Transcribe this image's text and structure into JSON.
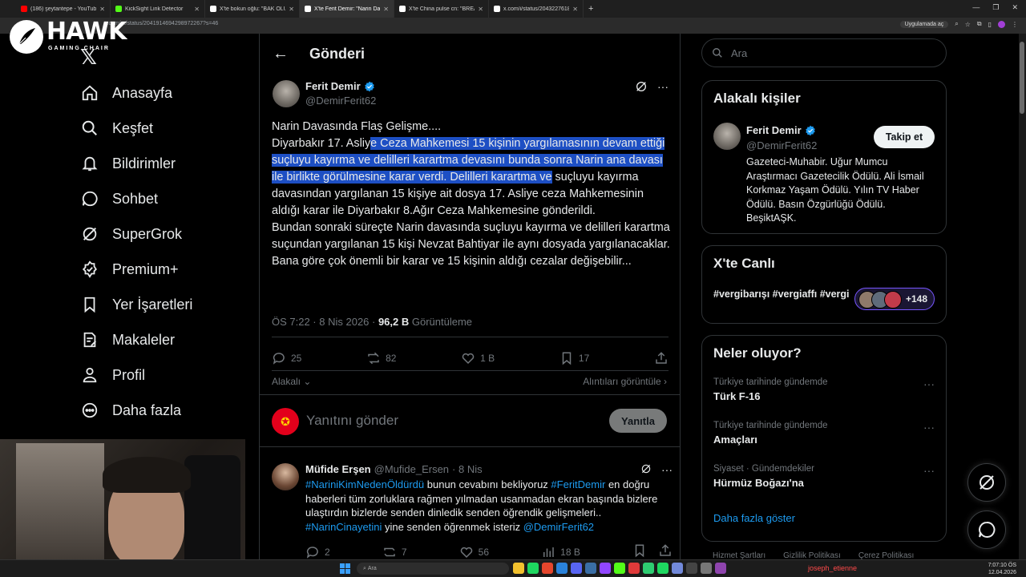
{
  "browser": {
    "tabs": [
      {
        "title": "(186) şeytantepe - YouTube",
        "color": "#ff0000"
      },
      {
        "title": "KickSight Link Detector",
        "color": "#53fc18"
      },
      {
        "title": "X'te bokun oğlu: \"BAK ÖLÜYOR",
        "color": "#ffffff"
      },
      {
        "title": "X'te Ferit Demir: \"Narin Davası",
        "color": "#ffffff"
      },
      {
        "title": "X'te China pulse cn: \"BREAKING",
        "color": "#ffffff"
      },
      {
        "title": "x.com/i/status/204322761853",
        "color": "#ffffff"
      }
    ],
    "url": "x.com/.../status/2041914694298972267?s=46",
    "profile_button": "Uygulamada aç"
  },
  "logo": {
    "word": "HAWK",
    "sub": "GAMING CHAIR"
  },
  "nav": {
    "items": [
      {
        "label": "Anasayfa",
        "icon": "home-icon"
      },
      {
        "label": "Keşfet",
        "icon": "search-icon"
      },
      {
        "label": "Bildirimler",
        "icon": "bell-icon"
      },
      {
        "label": "Sohbet",
        "icon": "chat-icon"
      },
      {
        "label": "SuperGrok",
        "icon": "grok-icon"
      },
      {
        "label": "Premium+",
        "icon": "premium-icon"
      },
      {
        "label": "Yer İşaretleri",
        "icon": "bookmark-icon"
      },
      {
        "label": "Makaleler",
        "icon": "article-icon"
      },
      {
        "label": "Profil",
        "icon": "profile-icon"
      },
      {
        "label": "Daha fazla",
        "icon": "more-icon"
      }
    ]
  },
  "header": {
    "title": "Gönderi"
  },
  "post": {
    "author_name": "Ferit Demir",
    "author_handle": "@DemirFerit62",
    "line1": "Narin Davasında Flaş Gelişme....",
    "line2_pre": "Diyarbakır 17. Asliy",
    "line2_sel": "e Ceza Mahkemesi 15 kişinin yargılamasının devam ettiği suçluyu kayırma ve delilleri karartma devasını bunda sonra Narin ana davası ile birlikte görülmesine karar verdi. Delilleri karartma ve",
    "line2_post": " suçluyu kayırma davasından yargılanan 15 kişiye ait dosya 17. Asliye ceza Mahkemesinin aldığı karar ile  Diyarbakır 8.Ağır Ceza Mahkemesine gönderildi.",
    "line3": "Bundan sonraki süreçte Narin davasında suçluyu kayırma ve delilleri karartma suçundan yargılanan 15 kişi   Nevzat Bahtiyar ile aynı dosyada yargılanacaklar.",
    "line4": "Bana göre çok önemli bir karar ve 15 kişinin aldığı cezalar değişebilir...",
    "time": "ÖS 7:22 · 8 Nis 2026 · ",
    "views": "96,2 B",
    "views_label": " Görüntüleme",
    "replies": "25",
    "reposts": "82",
    "likes": "1 B",
    "bookmarks": "17",
    "relevant": "Alakalı",
    "quotes": "Alıntıları görüntüle"
  },
  "reply_box": {
    "placeholder": "Yanıtını gönder",
    "button": "Yanıtla"
  },
  "reply": {
    "name": "Müfide Erşen",
    "handle": "@Mufide_Ersen",
    "date": "· 8 Nis",
    "tag1": "#NariniKimNedenÖldürdü",
    "text1": " bunun cevabını bekliyoruz ",
    "tag2": "#FeritDemir",
    "text2": " en doğru haberleri tüm zorluklara rağmen yılmadan usanmadan ekran başında bizlere ulaştırdın bizlerde  senden dinledik senden öğrendik gelişmeleri..",
    "tag3": "#NarinCinayetini",
    "text3": " yine senden öğrenmek isteriz ",
    "tag4": "@DemirFerit62",
    "replies": "2",
    "reposts": "7",
    "likes": "56",
    "views": "18 B"
  },
  "search": {
    "placeholder": "Ara"
  },
  "related": {
    "title": "Alakalı kişiler",
    "name": "Ferit Demir",
    "handle": "@DemirFerit62",
    "follow": "Takip et",
    "bio": "Gazeteci-Muhabir. Uğur Mumcu Araştırmacı Gazetecilik Ödülü. Ali İsmail Korkmaz Yaşam Ödülü. Yılın TV Haber Ödülü. Basın Özgürlüğü Ödülü. BeşiktAŞK."
  },
  "live": {
    "title": "X'te Canlı",
    "tags": "#vergibarışı #vergiaffı #vergi",
    "count": "+148"
  },
  "trends": {
    "title": "Neler oluyor?",
    "items": [
      {
        "context": "Türkiye tarihinde gündemde",
        "name": "Türk F-16"
      },
      {
        "context": "Türkiye tarihinde gündemde",
        "name": "Amaçları"
      },
      {
        "context": "Siyaset · Gündemdekiler",
        "name": "Hürmüz Boğazı'na"
      }
    ],
    "show_more": "Daha fazla göster"
  },
  "footer": {
    "links": [
      "Hizmet Şartları",
      "Gizlilik Politikası",
      "Çerez Politikası"
    ]
  },
  "taskbar": {
    "search": "Ara",
    "user": "joseph_etienne",
    "time": "7:07:10 ÖS",
    "date": "12.04.2026"
  },
  "colors": {
    "accent": "#1d9bf0",
    "selection": "#1d4fc4",
    "background": "#000000"
  }
}
